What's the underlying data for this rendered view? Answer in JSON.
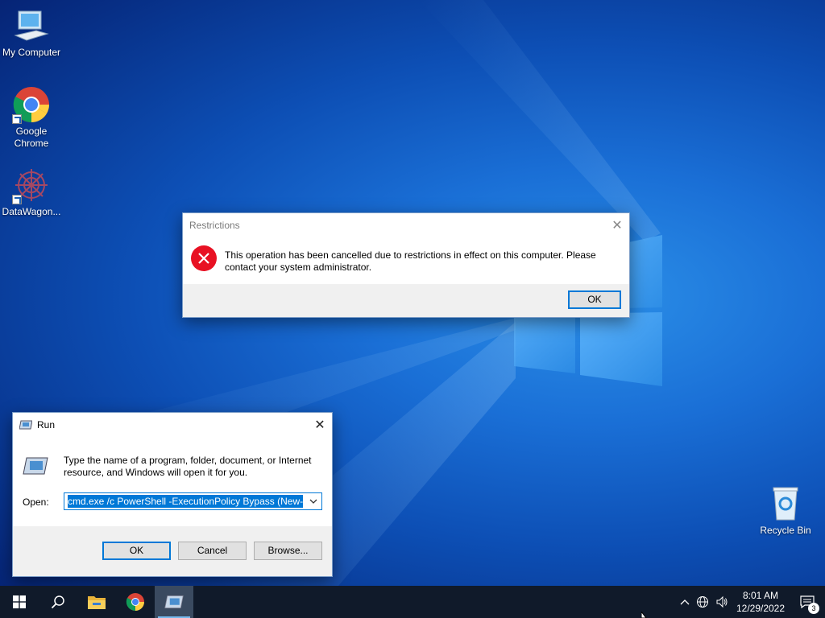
{
  "desktop": {
    "icons": [
      {
        "label": "My Computer",
        "icon": "computer-icon"
      },
      {
        "label": "Google Chrome",
        "icon": "chrome-icon"
      },
      {
        "label": "DataWagon...",
        "icon": "datawagon-icon"
      },
      {
        "label": "Recycle Bin",
        "icon": "recycle-bin-icon"
      }
    ]
  },
  "restrictions_dialog": {
    "title": "Restrictions",
    "message": "This operation has been cancelled due to restrictions in effect on this computer. Please contact your system administrator.",
    "ok_label": "OK",
    "icon": "error-icon"
  },
  "run_dialog": {
    "title": "Run",
    "description": "Type the name of a program, folder, document, or Internet resource, and Windows will open it for you.",
    "open_label": "Open:",
    "open_value": "cmd.exe /c PowerShell -ExecutionPolicy Bypass (New-O",
    "ok_label": "OK",
    "cancel_label": "Cancel",
    "browse_label": "Browse..."
  },
  "taskbar": {
    "items": [
      "start-icon",
      "search-icon",
      "file-explorer-icon",
      "chrome-icon",
      "run-icon"
    ],
    "time": "8:01 AM",
    "date": "12/29/2022",
    "notification_count": "3"
  },
  "colors": {
    "accent": "#0078d7",
    "error_red": "#e81123",
    "taskbar": "#101a2a"
  }
}
